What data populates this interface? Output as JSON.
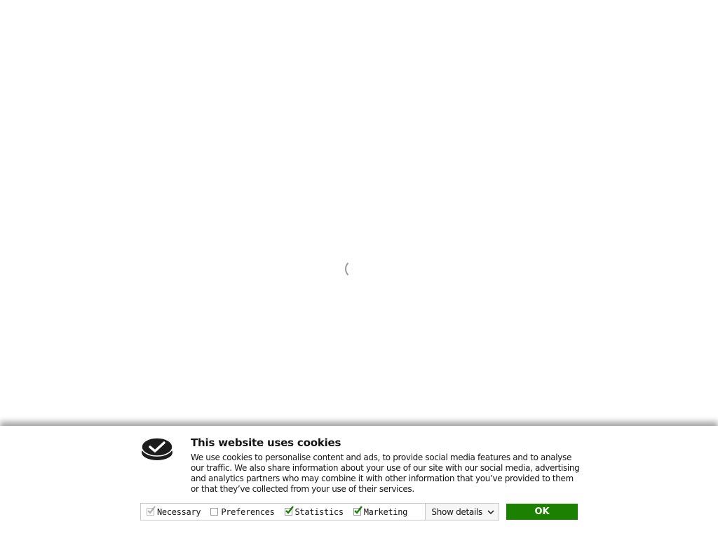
{
  "loading": {
    "spinner_icon": "loading-spinner-icon"
  },
  "cookie_banner": {
    "logo_icon": "cookiebot-check-icon",
    "title": "This website uses cookies",
    "body": "We use cookies to personalise content and ads, to provide social media features and to analyse our traffic. We also share information about your use of our site with our social media, advertising and analytics partners who may combine it with other information that you’ve provided to them or that they’ve collected from your use of their services.",
    "options": [
      {
        "label": "Necessary",
        "checked": true,
        "disabled": true
      },
      {
        "label": "Preferences",
        "checked": false,
        "disabled": false
      },
      {
        "label": "Statistics",
        "checked": true,
        "disabled": false
      },
      {
        "label": "Marketing",
        "checked": true,
        "disabled": false
      }
    ],
    "show_details_label": "Show details",
    "ok_label": "OK",
    "colors": {
      "accept": "#1a8200",
      "check_mark": "#1a8200",
      "disabled_check": "#b0b0b0",
      "text": "#141414"
    }
  }
}
